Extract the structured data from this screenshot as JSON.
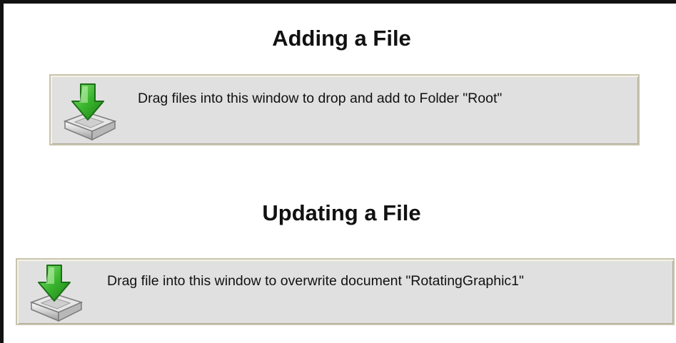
{
  "add_section": {
    "title": "Adding a File",
    "dropzone_text": "Drag files into this window to drop and add to Folder \"Root\""
  },
  "update_section": {
    "title": "Updating a File",
    "dropzone_text": "Drag file into this window to overwrite document \"RotatingGraphic1\""
  },
  "icons": {
    "dropzone_icon": "drop-tray-download-arrow-icon"
  },
  "colors": {
    "dropzone_background": "#e0e0e0",
    "arrow_green": "#39b52d",
    "heading_text": "#111111"
  }
}
